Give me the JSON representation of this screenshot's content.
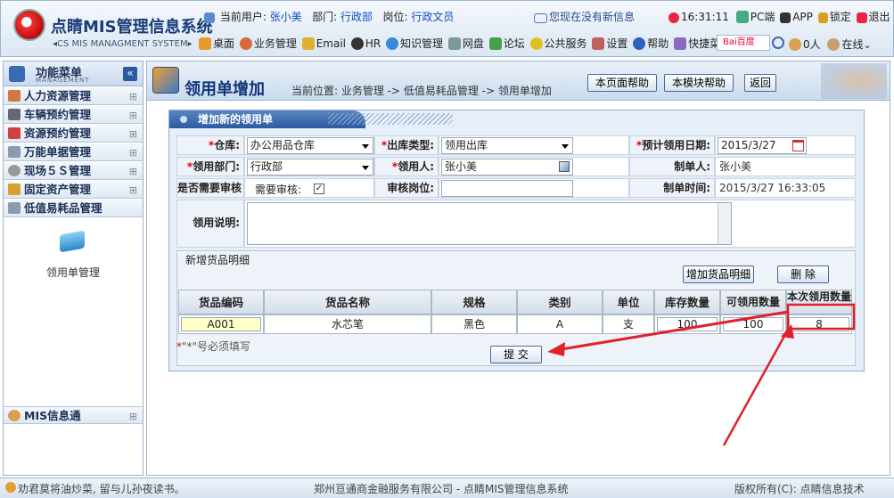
{
  "header": {
    "app_title": "点睛MIS管理信息系统",
    "app_subtitle": "◂CS MIS MANAGMENT SYSTEM▸",
    "current_user_label": "当前用户:",
    "current_user": "张小美",
    "dept_label": "部门:",
    "dept": "行政部",
    "post_label": "岗位:",
    "post": "行政文员",
    "messages": "您现在没有新信息",
    "time": "16:31:11",
    "pc": "PC端",
    "app": "APP",
    "lock": "锁定",
    "logout": "退出",
    "nav": [
      "桌面",
      "业务管理",
      "Email",
      "HR",
      "知识管理",
      "网盘",
      "论坛",
      "公共服务",
      "设置",
      "帮助",
      "快捷菜单"
    ],
    "baidu": "Bai百度",
    "online_count": "0人",
    "online": "在线"
  },
  "sidebar": {
    "title": "功能菜单",
    "subtitle": "MANAGEMENT",
    "collapse": "«",
    "items": [
      {
        "label": "人力资源管理"
      },
      {
        "label": "车辆预约管理"
      },
      {
        "label": "资源预约管理"
      },
      {
        "label": "万能单据管理"
      },
      {
        "label": "现场５Ｓ管理"
      },
      {
        "label": "固定资产管理"
      },
      {
        "label": "低值易耗品管理"
      }
    ],
    "sub_item": "领用单管理",
    "mis_title": "MIS信息通",
    "expand_symbol": "⊞"
  },
  "main": {
    "title": "领用单增加",
    "breadcrumb": "当前位置: 业务管理 -> 低值易耗品管理 -> 领用单增加",
    "buttons": {
      "page_help": "本页面帮助",
      "module_help": "本模块帮助",
      "back": "返回"
    }
  },
  "form": {
    "tab_title": "增加新的领用单",
    "warehouse_label": "仓库:",
    "warehouse": "办公用品仓库",
    "out_type_label": "出库类型:",
    "out_type": "领用出库",
    "expected_date_label": "预计领用日期:",
    "expected_date": "2015/3/27",
    "dept_label": "领用部门:",
    "dept": "行政部",
    "person_label": "领用人:",
    "person": "张小美",
    "creator_label": "制单人:",
    "creator": "张小美",
    "need_review_label": "是否需要审核",
    "need_review_text": "需要审核:",
    "review_post_label": "审核岗位:",
    "review_post": "",
    "created_time_label": "制单时间:",
    "created_time": "2015/3/27 16:33:05",
    "desc_label": "领用说明:",
    "desc": "",
    "detail_title": "新增货品明细",
    "add_detail": "增加货品明细",
    "delete": "删 除",
    "columns": [
      "货品编码",
      "货品名称",
      "规格",
      "类别",
      "单位",
      "库存数量",
      "可领用数量",
      "本次领用数量"
    ],
    "rows": [
      {
        "code": "A001",
        "name": "水芯笔",
        "spec": "黑色",
        "category": "A",
        "unit": "支",
        "stock": "100",
        "available": "100",
        "qty": "8"
      }
    ],
    "required_note_star": "*",
    "required_note": "\"*\"号必须填写",
    "submit": "提 交"
  },
  "footer": {
    "left": "劝君莫将油炒菜, 留与儿孙夜读书。",
    "center": "郑州亘通商金融服务有限公司 - 点睛MIS管理信息系统",
    "right": "版权所有(C): 点睛信息技术"
  },
  "colors": {
    "accent": "#1b3a78",
    "annotation": "#e0202a",
    "panel": "#e6eef8"
  }
}
